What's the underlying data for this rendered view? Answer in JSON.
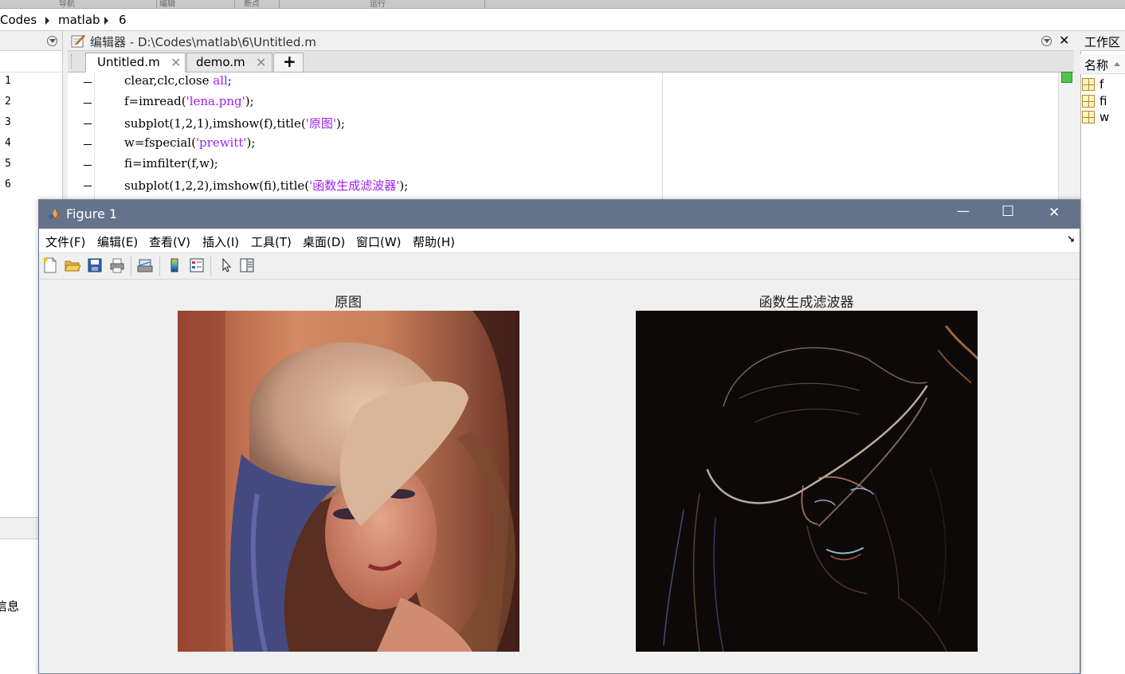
{
  "ribbon": {
    "tabs": [
      "导航",
      "编辑",
      "断点",
      "运行"
    ]
  },
  "address": {
    "crumbs": [
      "Codes",
      "matlab",
      "6"
    ]
  },
  "left_panel": {
    "partial_label": "信息"
  },
  "editor": {
    "title": "编辑器 - D:\\Codes\\matlab\\6\\Untitled.m",
    "tabs": [
      {
        "label": "Untitled.m"
      },
      {
        "label": "demo.m"
      }
    ],
    "add_tab": "+",
    "close_glyph": "✕",
    "lines": [
      {
        "num": "1",
        "pre": "clear,clc,close ",
        "str": "all",
        "post": ";"
      },
      {
        "num": "2",
        "pre": "f=imread(",
        "str": "'lena.png'",
        "post": ");"
      },
      {
        "num": "3",
        "pre": "subplot(1,2,1),imshow(f),title(",
        "str": "'原图'",
        "post": ");"
      },
      {
        "num": "4",
        "pre": "w=fspecial(",
        "str": "'prewitt'",
        "post": ");"
      },
      {
        "num": "5",
        "pre": "fi=imfilter(f,w);",
        "str": "",
        "post": ""
      },
      {
        "num": "6",
        "pre": "subplot(1,2,2),imshow(fi),title(",
        "str": "'函数生成滤波器'",
        "post": ");"
      }
    ]
  },
  "workspace": {
    "title": "工作区",
    "col_header": "名称",
    "vars": [
      "f",
      "fi",
      "w"
    ]
  },
  "figure": {
    "title": "Figure 1",
    "window_controls": {
      "minimize": "—",
      "maximize": "☐",
      "close": "✕"
    },
    "menu": [
      "文件(F)",
      "编辑(E)",
      "查看(V)",
      "插入(I)",
      "工具(T)",
      "桌面(D)",
      "窗口(W)",
      "帮助(H)"
    ],
    "menu_arrow": "↘",
    "axes": [
      {
        "title": "原图"
      },
      {
        "title": "函数生成滤波器"
      }
    ]
  },
  "colors": {
    "figure_titlebar": "#64738a",
    "string": "#a020f0",
    "indicator": "#4fc34f"
  }
}
